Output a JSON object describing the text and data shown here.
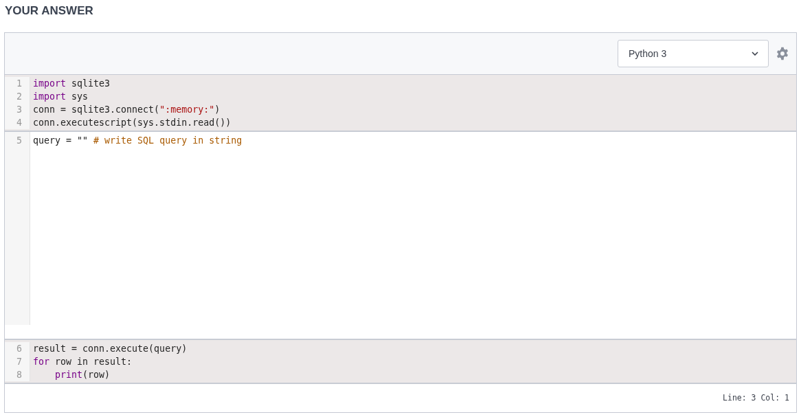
{
  "heading": "YOUR ANSWER",
  "toolbar": {
    "language": "Python 3"
  },
  "sections": [
    {
      "kind": "locked",
      "lines": [
        {
          "number": "1",
          "tokens": [
            {
              "kind": "keyword",
              "text": "import"
            },
            {
              "kind": "plain",
              "text": " sqlite3"
            }
          ]
        },
        {
          "number": "2",
          "tokens": [
            {
              "kind": "keyword",
              "text": "import"
            },
            {
              "kind": "plain",
              "text": " sys"
            }
          ]
        },
        {
          "number": "3",
          "tokens": [
            {
              "kind": "plain",
              "text": "conn = sqlite3.connect("
            },
            {
              "kind": "string",
              "text": "\":memory:\""
            },
            {
              "kind": "plain",
              "text": ")"
            }
          ]
        },
        {
          "number": "4",
          "tokens": [
            {
              "kind": "plain",
              "text": "conn.executescript(sys.stdin.read())"
            }
          ]
        }
      ]
    },
    {
      "kind": "editable",
      "lines": [
        {
          "number": "5",
          "tokens": [
            {
              "kind": "plain",
              "text": "query = \"\" "
            },
            {
              "kind": "comment",
              "text": "# write SQL query in string"
            }
          ]
        }
      ]
    },
    {
      "kind": "locked",
      "lines": [
        {
          "number": "6",
          "tokens": [
            {
              "kind": "plain",
              "text": "result = conn.execute(query)"
            }
          ]
        },
        {
          "number": "7",
          "tokens": [
            {
              "kind": "keyword",
              "text": "for"
            },
            {
              "kind": "plain",
              "text": " row in result:"
            }
          ]
        },
        {
          "number": "8",
          "tokens": [
            {
              "kind": "keyword",
              "text": "    print"
            },
            {
              "kind": "plain",
              "text": "(row)"
            }
          ]
        }
      ]
    }
  ],
  "status": "Line: 3 Col: 1"
}
